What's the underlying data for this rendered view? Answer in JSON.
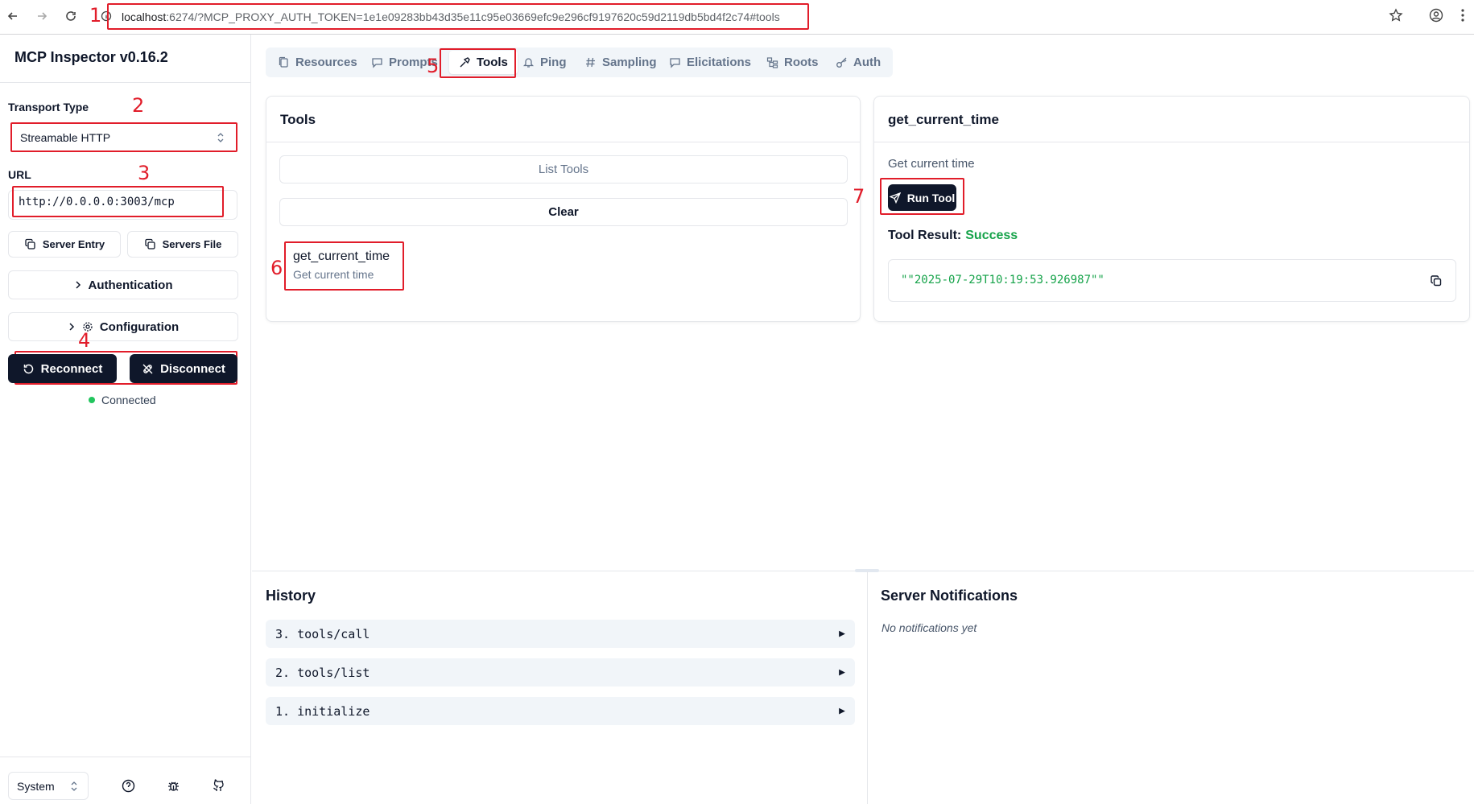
{
  "browser": {
    "url_host": "localhost",
    "url_rest": ":6274/?MCP_PROXY_AUTH_TOKEN=1e1e09283bb43d35e11c95e03669efc9e296cf9197620c59d2119db5bd4f2c74#tools"
  },
  "annotations": [
    "1",
    "2",
    "3",
    "4",
    "5",
    "6",
    "7"
  ],
  "sidebar": {
    "title": "MCP Inspector v0.16.2",
    "transport_label": "Transport Type",
    "transport_value": "Streamable HTTP",
    "url_label": "URL",
    "url_value": "http://0.0.0.0:3003/mcp",
    "server_entry_label": "Server Entry",
    "servers_file_label": "Servers File",
    "authentication_label": "Authentication",
    "configuration_label": "Configuration",
    "reconnect_label": "Reconnect",
    "disconnect_label": "Disconnect",
    "status_text": "Connected",
    "theme_value": "System"
  },
  "tabs": [
    {
      "label": "Resources",
      "icon": "files-icon"
    },
    {
      "label": "Prompts",
      "icon": "message-icon"
    },
    {
      "label": "Tools",
      "icon": "hammer-icon",
      "active": true
    },
    {
      "label": "Ping",
      "icon": "bell-icon"
    },
    {
      "label": "Sampling",
      "icon": "hash-icon"
    },
    {
      "label": "Elicitations",
      "icon": "message-icon"
    },
    {
      "label": "Roots",
      "icon": "folder-tree-icon"
    },
    {
      "label": "Auth",
      "icon": "key-icon"
    }
  ],
  "tools_panel": {
    "title": "Tools",
    "list_tools_label": "List Tools",
    "clear_label": "Clear",
    "items": [
      {
        "name": "get_current_time",
        "description": "Get current time"
      }
    ]
  },
  "tool_detail": {
    "title": "get_current_time",
    "description": "Get current time",
    "run_label": "Run Tool",
    "result_label": "Tool Result:",
    "result_status": "Success",
    "result_value": "\"\"2025-07-29T10:19:53.926987\"\""
  },
  "history": {
    "title": "History",
    "items": [
      "3. tools/call",
      "2. tools/list",
      "1. initialize"
    ]
  },
  "notifications": {
    "title": "Server Notifications",
    "empty_text": "No notifications yet"
  },
  "colors": {
    "accent_dark": "#0f172a",
    "annotation_red": "#e11d2a",
    "success_green": "#16a34a",
    "connected_dot": "#22c55e"
  }
}
